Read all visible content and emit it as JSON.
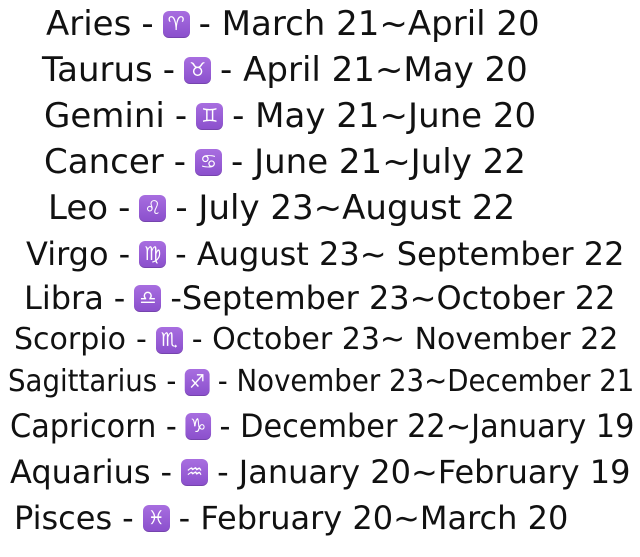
{
  "signs": [
    {
      "name": "Aries",
      "sep": "-",
      "symbol": "♈",
      "dates": "- March 21~April 20",
      "icon": "aries-icon"
    },
    {
      "name": "Taurus",
      "sep": "-",
      "symbol": "♉",
      "dates": "- April 21~May 20",
      "icon": "taurus-icon"
    },
    {
      "name": "Gemini",
      "sep": "-",
      "symbol": "♊",
      "dates": "- May 21~June 20",
      "icon": "gemini-icon"
    },
    {
      "name": "Cancer",
      "sep": "-",
      "symbol": "♋",
      "dates": "- June 21~July 22",
      "icon": "cancer-icon"
    },
    {
      "name": "Leo",
      "sep": "-",
      "symbol": "♌",
      "dates": "- July 23~August 22",
      "icon": "leo-icon"
    },
    {
      "name": "Virgo",
      "sep": "-",
      "symbol": "♍",
      "dates": "- August 23~ September 22",
      "icon": "virgo-icon"
    },
    {
      "name": "Libra",
      "sep": "-",
      "symbol": "♎",
      "dates": "-September 23~October 22",
      "icon": "libra-icon"
    },
    {
      "name": "Scorpio",
      "sep": "-",
      "symbol": "♏",
      "dates": "- October 23~ November 22",
      "icon": "scorpio-icon"
    },
    {
      "name": "Sagittarius",
      "sep": "-",
      "symbol": "♐",
      "dates": "- November 23~December 21",
      "icon": "sagittarius-icon"
    },
    {
      "name": "Capricorn",
      "sep": "-",
      "symbol": "♑",
      "dates": "- December 22~January 19",
      "icon": "capricorn-icon"
    },
    {
      "name": "Aquarius",
      "sep": "-",
      "symbol": "♒",
      "dates": "- January 20~February 19",
      "icon": "aquarius-icon"
    },
    {
      "name": "Pisces",
      "sep": "-",
      "symbol": "♓",
      "dates": "- February 20~March 20",
      "icon": "pisces-icon"
    }
  ],
  "colors": {
    "text": "#111111",
    "badge": "#9b5fd8",
    "background": "#ffffff"
  }
}
